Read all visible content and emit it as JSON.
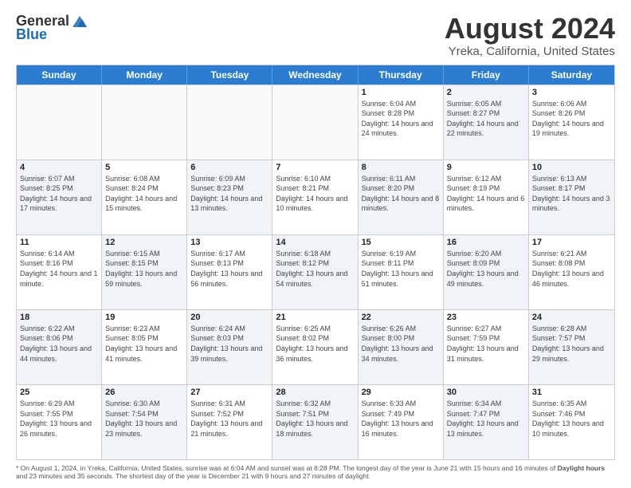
{
  "logo": {
    "general": "General",
    "blue": "Blue"
  },
  "title": "August 2024",
  "subtitle": "Yreka, California, United States",
  "days_of_week": [
    "Sunday",
    "Monday",
    "Tuesday",
    "Wednesday",
    "Thursday",
    "Friday",
    "Saturday"
  ],
  "weeks": [
    [
      {
        "day": "",
        "sunrise": "",
        "sunset": "",
        "daylight": "",
        "shaded": false,
        "empty": true
      },
      {
        "day": "",
        "sunrise": "",
        "sunset": "",
        "daylight": "",
        "shaded": false,
        "empty": true
      },
      {
        "day": "",
        "sunrise": "",
        "sunset": "",
        "daylight": "",
        "shaded": false,
        "empty": true
      },
      {
        "day": "",
        "sunrise": "",
        "sunset": "",
        "daylight": "",
        "shaded": false,
        "empty": true
      },
      {
        "day": "1",
        "sunrise": "Sunrise: 6:04 AM",
        "sunset": "Sunset: 8:28 PM",
        "daylight": "Daylight: 14 hours and 24 minutes.",
        "shaded": false,
        "empty": false
      },
      {
        "day": "2",
        "sunrise": "Sunrise: 6:05 AM",
        "sunset": "Sunset: 8:27 PM",
        "daylight": "Daylight: 14 hours and 22 minutes.",
        "shaded": true,
        "empty": false
      },
      {
        "day": "3",
        "sunrise": "Sunrise: 6:06 AM",
        "sunset": "Sunset: 8:26 PM",
        "daylight": "Daylight: 14 hours and 19 minutes.",
        "shaded": false,
        "empty": false
      }
    ],
    [
      {
        "day": "4",
        "sunrise": "Sunrise: 6:07 AM",
        "sunset": "Sunset: 8:25 PM",
        "daylight": "Daylight: 14 hours and 17 minutes.",
        "shaded": true,
        "empty": false
      },
      {
        "day": "5",
        "sunrise": "Sunrise: 6:08 AM",
        "sunset": "Sunset: 8:24 PM",
        "daylight": "Daylight: 14 hours and 15 minutes.",
        "shaded": false,
        "empty": false
      },
      {
        "day": "6",
        "sunrise": "Sunrise: 6:09 AM",
        "sunset": "Sunset: 8:23 PM",
        "daylight": "Daylight: 14 hours and 13 minutes.",
        "shaded": true,
        "empty": false
      },
      {
        "day": "7",
        "sunrise": "Sunrise: 6:10 AM",
        "sunset": "Sunset: 8:21 PM",
        "daylight": "Daylight: 14 hours and 10 minutes.",
        "shaded": false,
        "empty": false
      },
      {
        "day": "8",
        "sunrise": "Sunrise: 6:11 AM",
        "sunset": "Sunset: 8:20 PM",
        "daylight": "Daylight: 14 hours and 8 minutes.",
        "shaded": true,
        "empty": false
      },
      {
        "day": "9",
        "sunrise": "Sunrise: 6:12 AM",
        "sunset": "Sunset: 8:19 PM",
        "daylight": "Daylight: 14 hours and 6 minutes.",
        "shaded": false,
        "empty": false
      },
      {
        "day": "10",
        "sunrise": "Sunrise: 6:13 AM",
        "sunset": "Sunset: 8:17 PM",
        "daylight": "Daylight: 14 hours and 3 minutes.",
        "shaded": true,
        "empty": false
      }
    ],
    [
      {
        "day": "11",
        "sunrise": "Sunrise: 6:14 AM",
        "sunset": "Sunset: 8:16 PM",
        "daylight": "Daylight: 14 hours and 1 minute.",
        "shaded": false,
        "empty": false
      },
      {
        "day": "12",
        "sunrise": "Sunrise: 6:15 AM",
        "sunset": "Sunset: 8:15 PM",
        "daylight": "Daylight: 13 hours and 59 minutes.",
        "shaded": true,
        "empty": false
      },
      {
        "day": "13",
        "sunrise": "Sunrise: 6:17 AM",
        "sunset": "Sunset: 8:13 PM",
        "daylight": "Daylight: 13 hours and 56 minutes.",
        "shaded": false,
        "empty": false
      },
      {
        "day": "14",
        "sunrise": "Sunrise: 6:18 AM",
        "sunset": "Sunset: 8:12 PM",
        "daylight": "Daylight: 13 hours and 54 minutes.",
        "shaded": true,
        "empty": false
      },
      {
        "day": "15",
        "sunrise": "Sunrise: 6:19 AM",
        "sunset": "Sunset: 8:11 PM",
        "daylight": "Daylight: 13 hours and 51 minutes.",
        "shaded": false,
        "empty": false
      },
      {
        "day": "16",
        "sunrise": "Sunrise: 6:20 AM",
        "sunset": "Sunset: 8:09 PM",
        "daylight": "Daylight: 13 hours and 49 minutes.",
        "shaded": true,
        "empty": false
      },
      {
        "day": "17",
        "sunrise": "Sunrise: 6:21 AM",
        "sunset": "Sunset: 8:08 PM",
        "daylight": "Daylight: 13 hours and 46 minutes.",
        "shaded": false,
        "empty": false
      }
    ],
    [
      {
        "day": "18",
        "sunrise": "Sunrise: 6:22 AM",
        "sunset": "Sunset: 8:06 PM",
        "daylight": "Daylight: 13 hours and 44 minutes.",
        "shaded": true,
        "empty": false
      },
      {
        "day": "19",
        "sunrise": "Sunrise: 6:23 AM",
        "sunset": "Sunset: 8:05 PM",
        "daylight": "Daylight: 13 hours and 41 minutes.",
        "shaded": false,
        "empty": false
      },
      {
        "day": "20",
        "sunrise": "Sunrise: 6:24 AM",
        "sunset": "Sunset: 8:03 PM",
        "daylight": "Daylight: 13 hours and 39 minutes.",
        "shaded": true,
        "empty": false
      },
      {
        "day": "21",
        "sunrise": "Sunrise: 6:25 AM",
        "sunset": "Sunset: 8:02 PM",
        "daylight": "Daylight: 13 hours and 36 minutes.",
        "shaded": false,
        "empty": false
      },
      {
        "day": "22",
        "sunrise": "Sunrise: 6:26 AM",
        "sunset": "Sunset: 8:00 PM",
        "daylight": "Daylight: 13 hours and 34 minutes.",
        "shaded": true,
        "empty": false
      },
      {
        "day": "23",
        "sunrise": "Sunrise: 6:27 AM",
        "sunset": "Sunset: 7:59 PM",
        "daylight": "Daylight: 13 hours and 31 minutes.",
        "shaded": false,
        "empty": false
      },
      {
        "day": "24",
        "sunrise": "Sunrise: 6:28 AM",
        "sunset": "Sunset: 7:57 PM",
        "daylight": "Daylight: 13 hours and 29 minutes.",
        "shaded": true,
        "empty": false
      }
    ],
    [
      {
        "day": "25",
        "sunrise": "Sunrise: 6:29 AM",
        "sunset": "Sunset: 7:55 PM",
        "daylight": "Daylight: 13 hours and 26 minutes.",
        "shaded": false,
        "empty": false
      },
      {
        "day": "26",
        "sunrise": "Sunrise: 6:30 AM",
        "sunset": "Sunset: 7:54 PM",
        "daylight": "Daylight: 13 hours and 23 minutes.",
        "shaded": true,
        "empty": false
      },
      {
        "day": "27",
        "sunrise": "Sunrise: 6:31 AM",
        "sunset": "Sunset: 7:52 PM",
        "daylight": "Daylight: 13 hours and 21 minutes.",
        "shaded": false,
        "empty": false
      },
      {
        "day": "28",
        "sunrise": "Sunrise: 6:32 AM",
        "sunset": "Sunset: 7:51 PM",
        "daylight": "Daylight: 13 hours and 18 minutes.",
        "shaded": true,
        "empty": false
      },
      {
        "day": "29",
        "sunrise": "Sunrise: 6:33 AM",
        "sunset": "Sunset: 7:49 PM",
        "daylight": "Daylight: 13 hours and 16 minutes.",
        "shaded": false,
        "empty": false
      },
      {
        "day": "30",
        "sunrise": "Sunrise: 6:34 AM",
        "sunset": "Sunset: 7:47 PM",
        "daylight": "Daylight: 13 hours and 13 minutes.",
        "shaded": true,
        "empty": false
      },
      {
        "day": "31",
        "sunrise": "Sunrise: 6:35 AM",
        "sunset": "Sunset: 7:46 PM",
        "daylight": "Daylight: 13 hours and 10 minutes.",
        "shaded": false,
        "empty": false
      }
    ]
  ],
  "footer": {
    "part1": "* On August 1, 2024, in Yreka, California, United States, sunrise was at 6:04 AM and sunset was at 8:28 PM. The longest day of the year is June 21 with 15 hours and 16 minutes of",
    "part2": "Daylight hours",
    "part3": "and 23",
    "part4": "minutes and 35 seconds. The shortest day of the year is December 21 with 9 hours and 27 minutes of daylight."
  }
}
